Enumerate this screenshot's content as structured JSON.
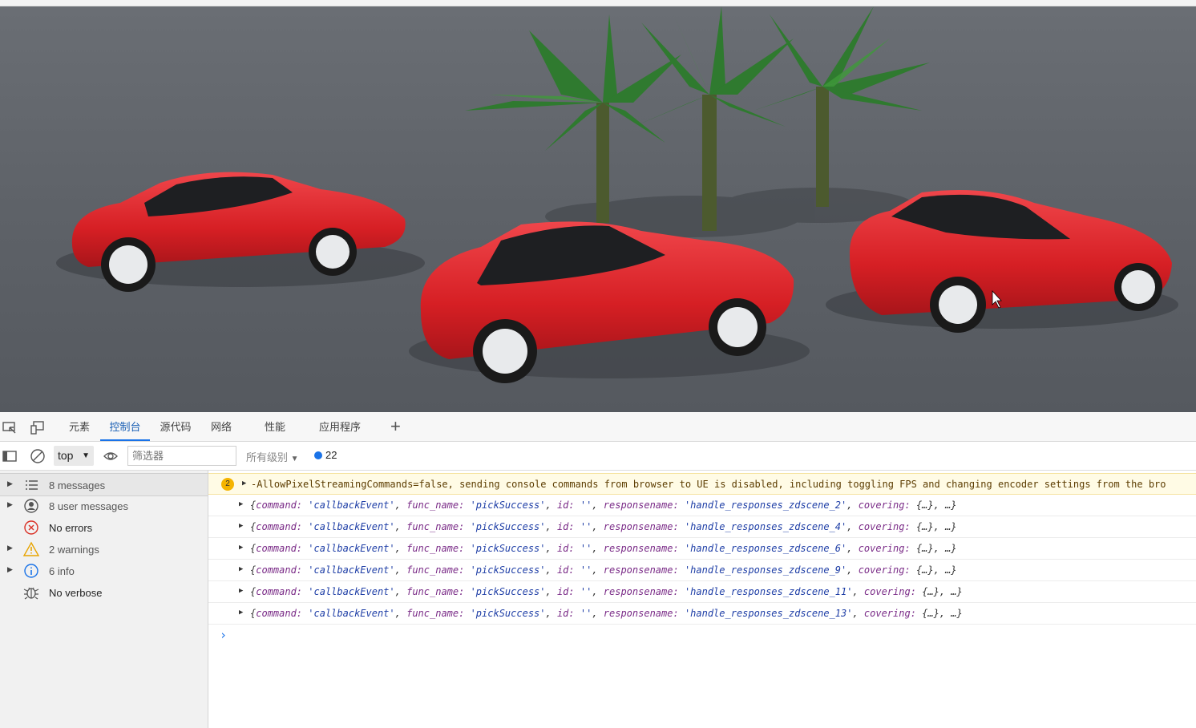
{
  "devtools": {
    "tabs": [
      {
        "label": "元素"
      },
      {
        "label": "控制台"
      },
      {
        "label": "源代码"
      },
      {
        "label": "网络"
      },
      {
        "label": "性能"
      },
      {
        "label": "应用程序"
      }
    ],
    "active_tab": "控制台",
    "add_tab_label": "+"
  },
  "toolbar": {
    "context": "top",
    "filter_placeholder": "筛选器",
    "levels_label": "所有级别",
    "issues_count": "22"
  },
  "sidebar": {
    "items": [
      {
        "label": "8 messages",
        "icon": "list-icon"
      },
      {
        "label": "8 user messages",
        "icon": "user-icon"
      },
      {
        "label": "No errors",
        "icon": "error-icon"
      },
      {
        "label": "2 warnings",
        "icon": "warning-icon"
      },
      {
        "label": "6 info",
        "icon": "info-icon"
      },
      {
        "label": "No verbose",
        "icon": "bug-icon"
      }
    ]
  },
  "console": {
    "warning": {
      "count": "2",
      "text": "-AllowPixelStreamingCommands=false, sending console commands from browser to UE is disabled, including toggling FPS and changing encoder settings from the bro"
    },
    "logs": [
      {
        "scene": "'handle_responses_zdscene_2'"
      },
      {
        "scene": "'handle_responses_zdscene_4'"
      },
      {
        "scene": "'handle_responses_zdscene_6'"
      },
      {
        "scene": "'handle_responses_zdscene_9'"
      },
      {
        "scene": "'handle_responses_zdscene_11'"
      },
      {
        "scene": "'handle_responses_zdscene_13'"
      }
    ],
    "log_parts": {
      "open": "{",
      "k_command": "command:",
      "v_command": "'callbackEvent'",
      "k_func": "func_name:",
      "v_func": "'pickSuccess'",
      "k_id": "id:",
      "v_id": "''",
      "k_resp": "responsename:",
      "k_cover": "covering:",
      "tail": "{…}, …}"
    },
    "prompt": "›"
  },
  "colors": {
    "accent": "#1a73e8",
    "car": "#d61f24",
    "ground": "#5a5e64",
    "warning_bg": "#fffbe5"
  }
}
